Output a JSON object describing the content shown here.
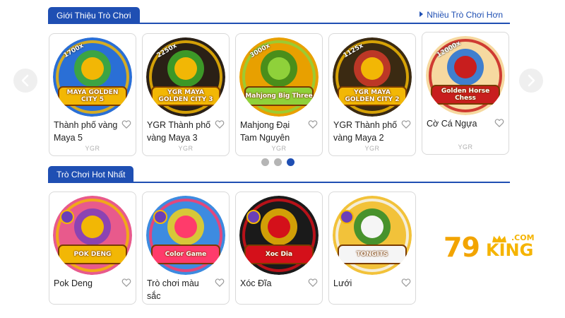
{
  "intro_section": {
    "title": "Giới Thiệu Trò Chơi",
    "more_link": "Nhiều Trò Chơi Hơn",
    "games": [
      {
        "title": "Thành phố vàng Maya 5",
        "provider": "YGR",
        "art_text": "MAYA GOLDEN CITY 5",
        "multiplier": "1700x",
        "icon": "golden-eagle-icon",
        "colors": {
          "bg": "#2a6fd6",
          "main": "#f2b705",
          "accent": "#3fae2a"
        }
      },
      {
        "title": "YGR Thành phố vàng Maya 3",
        "provider": "YGR",
        "art_text": "YGR MAYA GOLDEN CITY 3",
        "multiplier": "2250x",
        "icon": "maya-mask-icon",
        "colors": {
          "bg": "#2a2016",
          "main": "#f2b705",
          "accent": "#3fae2a"
        }
      },
      {
        "title": "Mahjong Đại Tam Nguyên",
        "provider": "YGR",
        "art_text": "Mahjong Big Three",
        "multiplier": "3000x",
        "icon": "mahjong-tiles-icon",
        "colors": {
          "bg": "#e8a000",
          "main": "#8fd13a",
          "accent": "#2e8b1e"
        }
      },
      {
        "title": "YGR Thành phố vàng Maya 2",
        "provider": "YGR",
        "art_text": "YGR MAYA GOLDEN CITY 2",
        "multiplier": "1125x",
        "icon": "maya-sun-disc-icon",
        "colors": {
          "bg": "#3b2a12",
          "main": "#f2b705",
          "accent": "#d43a2a"
        }
      },
      {
        "title": "Cờ Cá Ngựa",
        "provider": "YGR",
        "art_text": "Golden Horse Chess",
        "multiplier": "12000x",
        "icon": "horse-heads-icon",
        "colors": {
          "bg": "#f6d9a0",
          "main": "#c81e1e",
          "accent": "#1e6fd6"
        }
      }
    ]
  },
  "hot_section": {
    "title": "Trò Chơi Hot Nhất",
    "games": [
      {
        "title": "Pok Deng",
        "art_text": "POK DENG",
        "icon": "playing-cards-icon",
        "colors": {
          "bg": "#e85a8c",
          "main": "#f2b705",
          "accent": "#7b3fb8"
        }
      },
      {
        "title": "Trò chơi màu sắc",
        "art_text": "Color Game",
        "icon": "color-cubes-icon",
        "colors": {
          "bg": "#3d8be0",
          "main": "#ff3b6b",
          "accent": "#f2d21a"
        }
      },
      {
        "title": "Xóc Đĩa",
        "art_text": "Xoc Dia",
        "icon": "coins-plate-icon",
        "colors": {
          "bg": "#1a1a1a",
          "main": "#d4101a",
          "accent": "#f2b705"
        }
      },
      {
        "title": "Lưới",
        "art_text": "TONGITS",
        "icon": "card-fan-icon",
        "colors": {
          "bg": "#f2c23a",
          "main": "#f5f5f5",
          "accent": "#2a8a2a"
        }
      }
    ]
  },
  "carousel": {
    "page_count": 3,
    "active_index": 2
  },
  "brand": {
    "number": "79",
    "name": "KING",
    "suffix": ".COM",
    "color": "#f2a400"
  },
  "theme": {
    "primary": "#1f4fb3",
    "heart": "#9a9a9a"
  }
}
